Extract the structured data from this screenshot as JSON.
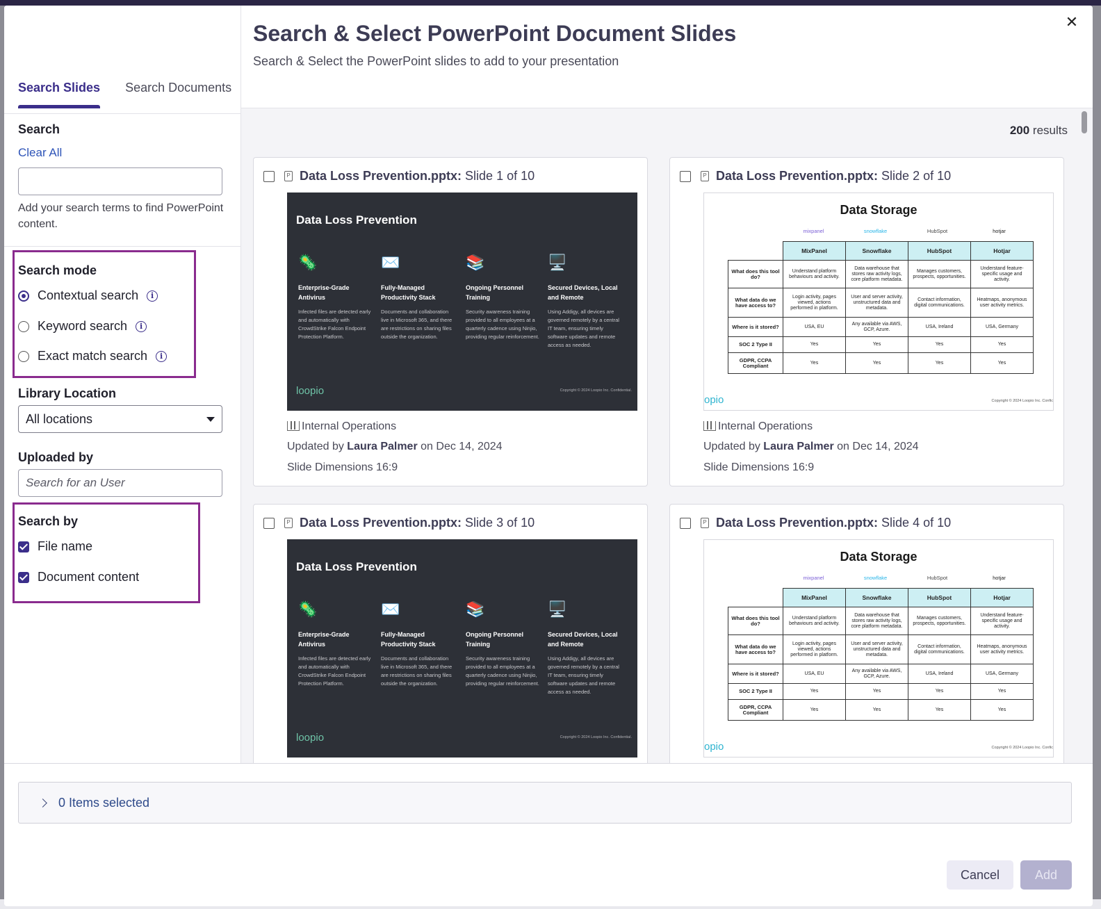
{
  "window": {
    "close_glyph": "✕"
  },
  "header": {
    "title": "Search & Select PowerPoint Document Slides",
    "subtitle": "Search & Select the PowerPoint slides to add to your presentation"
  },
  "tabs": [
    {
      "label": "Search Slides",
      "active": true
    },
    {
      "label": "Search Documents",
      "active": false
    }
  ],
  "search": {
    "title": "Search",
    "clear_all": "Clear All",
    "value": "",
    "placeholder": "",
    "helper": "Add your search terms to find PowerPoint content."
  },
  "search_mode": {
    "title": "Search mode",
    "options": [
      {
        "label": "Contextual search",
        "selected": true
      },
      {
        "label": "Keyword search",
        "selected": false
      },
      {
        "label": "Exact match search",
        "selected": false
      }
    ]
  },
  "library_location": {
    "title": "Library Location",
    "value": "All locations"
  },
  "uploaded_by": {
    "title": "Uploaded by",
    "placeholder": "Search for an User"
  },
  "search_by": {
    "title": "Search by",
    "options": [
      {
        "label": "File name",
        "checked": true
      },
      {
        "label": "Document content",
        "checked": true
      }
    ]
  },
  "results": {
    "count": "200",
    "label": "results"
  },
  "cards": [
    {
      "file": "Data Loss Prevention.pptx:",
      "slide": "Slide 1 of 10",
      "checked": false,
      "library": "Internal Operations",
      "updated_prefix": "Updated by",
      "author": "Laura Palmer",
      "updated_date": "on Dec 14, 2024",
      "dimensions": "Slide Dimensions 16:9"
    },
    {
      "file": "Data Loss Prevention.pptx:",
      "slide": "Slide 2 of 10",
      "checked": false,
      "library": "Internal Operations",
      "updated_prefix": "Updated by",
      "author": "Laura Palmer",
      "updated_date": "on Dec 14, 2024",
      "dimensions": "Slide Dimensions 16:9"
    },
    {
      "file": "Data Loss Prevention.pptx:",
      "slide": "Slide 3 of 10",
      "checked": false
    },
    {
      "file": "Data Loss Prevention.pptx:",
      "slide": "Slide 4 of 10",
      "checked": false
    }
  ],
  "slide_dark": {
    "title": "Data Loss Prevention",
    "columns": [
      {
        "icon": "🦠",
        "heading": "Enterprise-Grade Antivirus",
        "body": "Infected files are detected early and automatically with CrowdStrike Falcon Endpoint Protection Platform."
      },
      {
        "icon": "✉️",
        "heading": "Fully-Managed Productivity Stack",
        "body": "Documents and collaboration live in Microsoft 365, and there are restrictions on sharing files outside the organization."
      },
      {
        "icon": "📚",
        "heading": "Ongoing Personnel Training",
        "body": "Security awareness training provided to all employees at a quarterly cadence using Ninjio, providing regular reinforcement."
      },
      {
        "icon": "🖥️",
        "heading": "Secured Devices, Local and Remote",
        "body": "Using Addigy, all devices are governed remotely by a central IT team, ensuring timely software updates and remote access as needed."
      }
    ],
    "logo": "loopio",
    "copyright": "Copyright © 2024 Loopio Inc. Confidential."
  },
  "slide_light": {
    "title": "Data Storage",
    "brands": [
      "mixpanel",
      "snowflake",
      "HubSpot",
      "hotjar"
    ],
    "columns": [
      "MixPanel",
      "Snowflake",
      "HubSpot",
      "Hotjar"
    ],
    "rows": [
      {
        "label": "What does this tool do?",
        "cells": [
          "Understand platform behaviours and activity.",
          "Data warehouse that stores raw activity logs, core platform metadata.",
          "Manages customers, prospects, opportunities.",
          "Understand feature-specific usage and activity."
        ]
      },
      {
        "label": "What data do we have access to?",
        "cells": [
          "Login activity, pages viewed, actions performed in platform.",
          "User and server activity, unstructured data and metadata.",
          "Contact information, digital communications.",
          "Heatmaps, anonymous user activity metrics."
        ]
      },
      {
        "label": "Where is it stored?",
        "cells": [
          "USA, EU",
          "Any available via AWS, GCP, Azure.",
          "USA, Ireland",
          "USA, Germany"
        ]
      },
      {
        "label": "SOC 2 Type II",
        "cells": [
          "Yes",
          "Yes",
          "Yes",
          "Yes"
        ]
      },
      {
        "label": "GDPR, CCPA Compliant",
        "cells": [
          "Yes",
          "Yes",
          "Yes",
          "Yes"
        ]
      }
    ],
    "logo": "opio",
    "copyright": "Copyright © 2024 Loopio Inc. Confic"
  },
  "footer": {
    "selected_label": "0 Items selected",
    "cancel_label": "Cancel",
    "add_label": "Add"
  },
  "colors": {
    "accent": "#3b2e8a",
    "highlight_box": "#8a2b8e",
    "link": "#2e54b8"
  }
}
